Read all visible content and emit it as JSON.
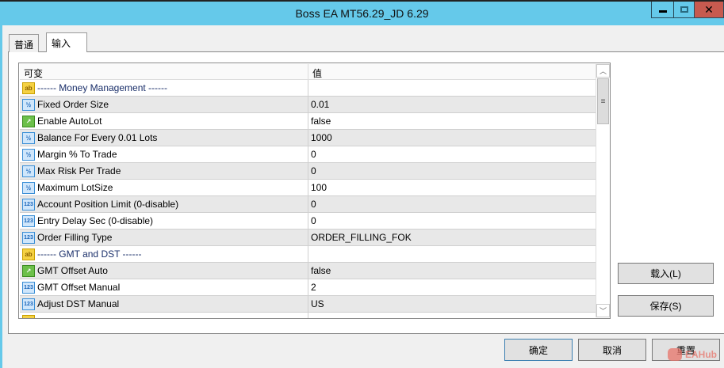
{
  "window": {
    "title": "Boss EA MT56.29_JD 6.29"
  },
  "tabs": [
    {
      "label": "普通"
    },
    {
      "label": "输入"
    }
  ],
  "table": {
    "headers": [
      "可变",
      "值"
    ],
    "rows": [
      {
        "icon": "ab",
        "name": "------ Money Management ------",
        "value": ""
      },
      {
        "icon": "fraction",
        "name": "Fixed Order Size",
        "value": "0.01"
      },
      {
        "icon": "bool",
        "name": "Enable AutoLot",
        "value": "false"
      },
      {
        "icon": "fraction",
        "name": "Balance For Every 0.01 Lots",
        "value": "1000"
      },
      {
        "icon": "fraction",
        "name": "Margin % To Trade",
        "value": "0"
      },
      {
        "icon": "fraction",
        "name": "Max Risk Per Trade",
        "value": "0"
      },
      {
        "icon": "fraction",
        "name": "Maximum LotSize",
        "value": "100"
      },
      {
        "icon": "int",
        "name": "Account Position Limit (0-disable)",
        "value": "0"
      },
      {
        "icon": "int",
        "name": "Entry Delay Sec (0-disable)",
        "value": "0"
      },
      {
        "icon": "int",
        "name": "Order Filling Type",
        "value": "ORDER_FILLING_FOK"
      },
      {
        "icon": "ab",
        "name": "------ GMT and DST ------",
        "value": ""
      },
      {
        "icon": "bool",
        "name": "GMT Offset Auto",
        "value": "false"
      },
      {
        "icon": "int",
        "name": "GMT Offset Manual",
        "value": "2"
      },
      {
        "icon": "int",
        "name": "Adjust DST Manual",
        "value": "US"
      }
    ]
  },
  "buttons": {
    "load": "载入(L)",
    "save": "保存(S)",
    "ok": "确定",
    "cancel": "取消",
    "reset": "重置"
  },
  "watermark": "EAHub"
}
